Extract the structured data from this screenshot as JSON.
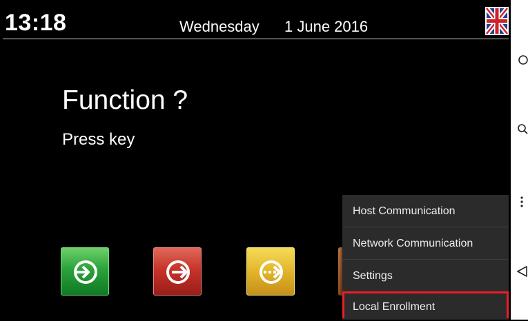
{
  "header": {
    "time": "13:18",
    "day": "Wednesday",
    "date": "1 June 2016",
    "language_flag": "uk-flag-icon"
  },
  "main": {
    "title": "Function ?",
    "subtitle": "Press key"
  },
  "function_keys": [
    {
      "name": "green-enter-key",
      "icon": "arrow-in-circle-icon",
      "color": "#2aa33a"
    },
    {
      "name": "red-exit-key",
      "icon": "arrow-out-circle-icon",
      "color": "#c7342a"
    },
    {
      "name": "yellow-key",
      "icon": "dashed-arrow-circle-icon",
      "color": "#e2b52b"
    },
    {
      "name": "brown-key",
      "icon": "",
      "color": "#a2521d"
    }
  ],
  "menu": {
    "items": [
      {
        "label": "Host Communication"
      },
      {
        "label": "Network Communication"
      },
      {
        "label": "Settings"
      },
      {
        "label": "Local Enrollment",
        "highlighted": true
      }
    ]
  },
  "nav_bar": {
    "icons": [
      "home-circle-icon",
      "search-icon",
      "more-vert-icon",
      "back-triangle-icon"
    ]
  },
  "colors": {
    "background": "#000000",
    "menu_background": "#2b2b2b",
    "highlight": "#ea1f25"
  }
}
